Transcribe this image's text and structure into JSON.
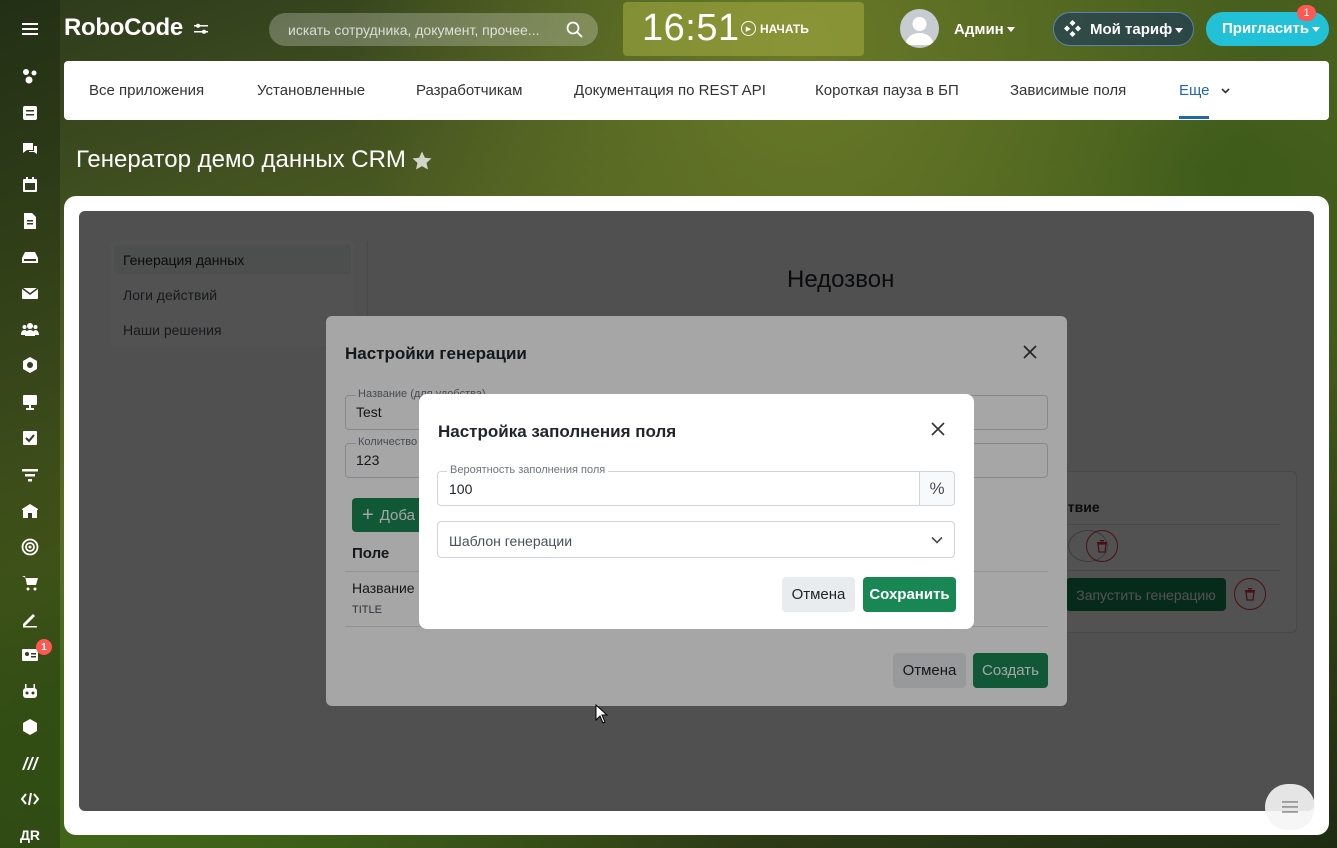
{
  "header": {
    "logo": "RoboCode",
    "search_placeholder": "искать сотрудника, документ, прочее...",
    "clock_time": "16:51",
    "clock_action": "НАЧАТЬ",
    "user_name": "Админ",
    "tariff_label": "Мой тариф",
    "invite_label": "Пригласить",
    "invite_badge": "1"
  },
  "leftbar": {
    "badge_count": "1",
    "bottom_label": "ДR",
    "icons": [
      "menu-icon",
      "activity-icon",
      "feed-icon",
      "chat-icon",
      "calendar-icon",
      "docs-icon",
      "drive-icon",
      "mail-icon",
      "groups-icon",
      "crm-icon",
      "projects-icon",
      "tasks-icon",
      "filter-icon",
      "store-icon",
      "target-icon",
      "cart-icon",
      "sign-icon",
      "contacts-icon",
      "robot-icon",
      "box-icon",
      "brand-icon",
      "code-icon"
    ]
  },
  "topnav": {
    "items": [
      "Все приложения",
      "Установленные",
      "Разработчикам",
      "Документация по REST API",
      "Короткая пауза в БП",
      "Зависимые поля"
    ],
    "more": "Еще"
  },
  "page": {
    "title": "Генератор демо данных CRM"
  },
  "app": {
    "side": [
      "Генерация данных",
      "Логи действий",
      "Наши решения"
    ],
    "heading": "Недозвон",
    "card_header": "ствие",
    "run_button": "Запустить генерацию"
  },
  "modal1": {
    "title": "Настройки генерации",
    "name_label": "Название (для удобства)",
    "name_value": "Test",
    "count_label": "Количество с",
    "count_value": "123",
    "add_button": "Доба",
    "column_header": "Поле",
    "row_name": "Название",
    "row_code": "TITLE",
    "cancel": "Отмена",
    "create": "Создать"
  },
  "modal2": {
    "title": "Настройка заполнения поля",
    "probability_label": "Вероятность заполнения поля",
    "probability_value": "100",
    "percent_symbol": "%",
    "template_value": "Шаблон генерации",
    "cancel": "Отмена",
    "save": "Сохранить"
  },
  "colors": {
    "accent_blue": "#2067b0",
    "success_green": "#198754",
    "invite_cyan": "#22c1d8",
    "danger_red": "#dc3545"
  }
}
